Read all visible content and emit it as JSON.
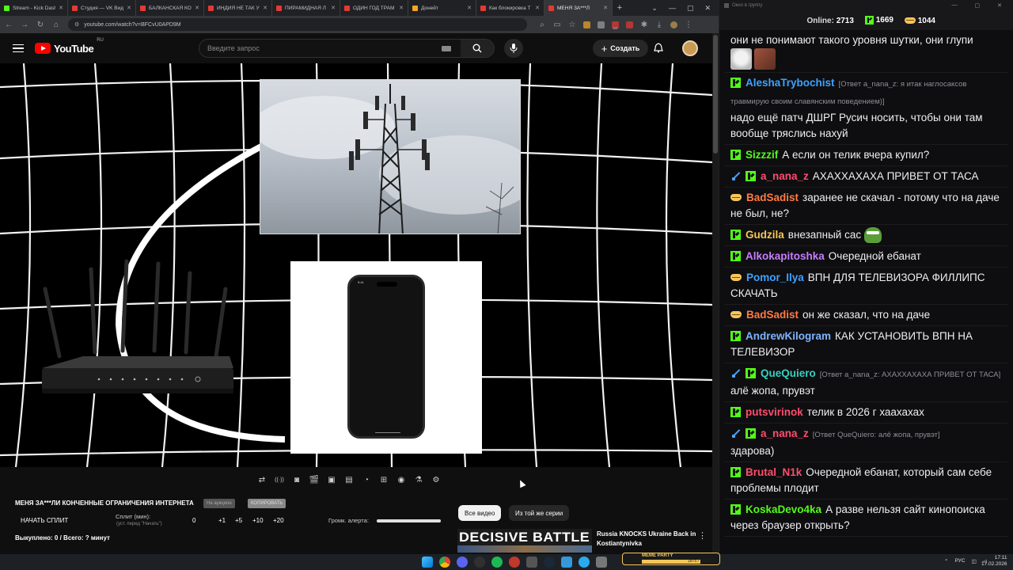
{
  "browser": {
    "tabs": [
      {
        "label": "Stream - Kick Dash",
        "color": "#53fc18",
        "active": false
      },
      {
        "label": "Студия — VK Видео",
        "color": "#e53935",
        "active": false
      },
      {
        "label": "БАЛКАНСКАЯ КО",
        "color": "#e53935",
        "active": false
      },
      {
        "label": "ИНДИЯ НЕ ТАК У",
        "color": "#e53935",
        "active": false
      },
      {
        "label": "ПИРАМИДНАЯ Л",
        "color": "#e53935",
        "active": false
      },
      {
        "label": "ОДИН ГОД ТРАМ",
        "color": "#e53935",
        "active": false
      },
      {
        "label": "Донейт",
        "color": "#f6a623",
        "active": false
      },
      {
        "label": "Как блокировка Т",
        "color": "#e53935",
        "active": false
      },
      {
        "label": "МЕНЯ ЗА***Л",
        "color": "#e53935",
        "active": true
      }
    ],
    "new_tab": "+",
    "url": "youtube.com/watch?v=BFCvU0APD9M",
    "ext_badges": [
      "112"
    ]
  },
  "youtube": {
    "logo": "YouTube",
    "region": "RU",
    "search_placeholder": "Введите запрос",
    "create_label": "Создать"
  },
  "controls": {
    "icons": [
      "repeat-icon",
      "broadcast-icon",
      "screen-record-icon",
      "clapper-icon",
      "picture-in-picture-icon",
      "subtitles-icon",
      "speed-icon",
      "screenshot-icon",
      "camera-icon",
      "flask-icon",
      "settings-icon"
    ]
  },
  "stream_panel": {
    "title": "МЕНЯ ЗА***ЛИ КОНЧЕННЫЕ ОГРАНИЧЕНИЯ ИНТЕРНЕТА",
    "btn1": "На аукцион",
    "btn2": "КОПИРОВАТЬ",
    "split": "НАЧАТЬ СПЛИТ",
    "split_min": "Сплит (мин):",
    "split_sub": "(уст. перед \"Начать\")",
    "values": [
      "0",
      "+1",
      "+5",
      "+10",
      "+20"
    ],
    "volume_label": "Громк. алерта:",
    "volume_level": 1.0,
    "bought": "Выкуплено: 0 / Всего: ? минут"
  },
  "recommendations": {
    "chip_all": "Все видео",
    "chip_series": "Из той же серии",
    "thumb_text": "DECISIVE BATTLE",
    "title": "Russia KNOCKS Ukraine Back in Kostiantynivka"
  },
  "chat": {
    "window_title": "Окно в группу",
    "online_label": "Online:",
    "online": "2713",
    "kick_count": "1669",
    "other_count": "1044",
    "messages": [
      {
        "user": "",
        "color": "#efeff1",
        "badges": [],
        "reply": "",
        "text": "они не понимают такого уровня шутки, они глупи",
        "emotes": [
          "cat",
          "photo"
        ]
      },
      {
        "user": "AleshaTrybochist",
        "color": "#3ea2ff",
        "badges": [
          "k"
        ],
        "reply": "[Ответ a_nana_z: я итак наглосаксов травмирую своим славянским поведением)]",
        "text": "надо ещё патч ДШРГ Русич носить, чтобы они там вообще тряслись нахуй"
      },
      {
        "user": "Sizzzif",
        "color": "#53fc18",
        "badges": [
          "k"
        ],
        "reply": "",
        "text": "А если он телик вчера купил?"
      },
      {
        "user": "a_nana_z",
        "color": "#ff4d6d",
        "badges": [
          "sw",
          "k"
        ],
        "reply": "",
        "text": "АХАХХАХАХА ПРИВЕТ ОТ ТАСА"
      },
      {
        "user": "BadSadist",
        "color": "#ff7a45",
        "badges": [
          "lip"
        ],
        "reply": "",
        "text": "заранее не скачал - потому что на даче не был, не?"
      },
      {
        "user": "Gudzila",
        "color": "#f6c65b",
        "badges": [
          "k"
        ],
        "reply": "",
        "text": "внезапный сас",
        "pepe": true
      },
      {
        "user": "Alkokapitoshka",
        "color": "#c77dff",
        "badges": [
          "k"
        ],
        "reply": "",
        "text": "Очередной ебанат"
      },
      {
        "user": "Pomor_Ilya",
        "color": "#3ea2ff",
        "badges": [
          "lip"
        ],
        "reply": "",
        "text": "ВПН ДЛЯ ТЕЛЕВИЗОРА ФИЛЛИПС СКАЧАТЬ"
      },
      {
        "user": "BadSadist",
        "color": "#ff7a45",
        "badges": [
          "lip"
        ],
        "reply": "",
        "text": "он же сказал, что на даче"
      },
      {
        "user": "AndrewKilogram",
        "color": "#7fb3ff",
        "badges": [
          "k"
        ],
        "reply": "",
        "text": "КАК УСТАНОВИТЬ ВПН НА ТЕЛЕВИЗОР"
      },
      {
        "user": "QueQuiero",
        "color": "#35d0c0",
        "badges": [
          "sw",
          "k"
        ],
        "reply": "[Ответ a_nana_z: АХАХХАХАХА ПРИВЕТ ОТ ТАСА]",
        "text": "алё жопа, прувэт"
      },
      {
        "user": "putsvirinok",
        "color": "#ff4d6d",
        "badges": [
          "k"
        ],
        "reply": "",
        "text": "телик в 2026 г хаахахах"
      },
      {
        "user": "a_nana_z",
        "color": "#ff4d6d",
        "badges": [
          "sw",
          "k"
        ],
        "reply": "[Ответ QueQuiero: алё жопа, прувэт]",
        "text": "здарова)"
      },
      {
        "user": "Brutal_N1k",
        "color": "#ff4d6d",
        "badges": [
          "k"
        ],
        "reply": "",
        "text": "Очередной ебанат, который сам себе проблемы плодит"
      },
      {
        "user": "KoskaDevo4ka",
        "color": "#53fc18",
        "badges": [
          "k"
        ],
        "reply": "",
        "text": "А разве нельзя сайт кинопоиска через браузер открыть?"
      }
    ]
  },
  "taskbar": {
    "widget_label": "MEME PARTY",
    "widget_count": "1875 / 1500",
    "widget_progress": 1.0,
    "lang": "РУС",
    "time": "17:11",
    "date": "17.02.2026"
  }
}
